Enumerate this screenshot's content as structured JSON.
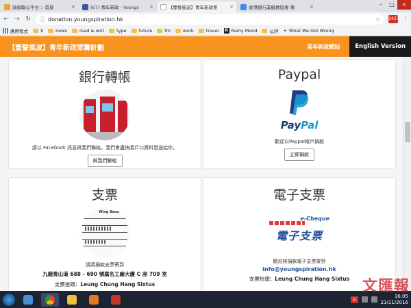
{
  "browser": {
    "tabs": [
      {
        "label": "誠倡聯公平台 :: 首頁",
        "color": "#e8a43a"
      },
      {
        "label": "(67) 青年新政 - Youngs",
        "color": "#3b5998"
      },
      {
        "label": "【壹誓風波】青年新政第",
        "color": "#aaaaaa"
      },
      {
        "label": "香港銀行業僱員協會 陳",
        "color": "#4285f4"
      }
    ],
    "url": "donation.youngspiration.hk",
    "extension_badge": "2427",
    "bookmarks": [
      "應用程式",
      "$",
      "news",
      "read & writ",
      "type",
      "future",
      "fm",
      "work",
      "travel",
      "Rainy Mood",
      "公評",
      "What We Got Wrong"
    ]
  },
  "site": {
    "title": "【壹誓風波】青年新政眾籌計劃",
    "home_link": "青年新政網站",
    "english_button": "English Version"
  },
  "cards": {
    "bank": {
      "title": "銀行轉帳",
      "desc": "請以 Facebook 訊息與我們聯絡，我們會盡快將戶口資料發送給你。",
      "button": "與我們聯絡"
    },
    "paypal": {
      "title": "Paypal",
      "logo_pay": "Pay",
      "logo_pal": "Pal",
      "desc": "歡迎以Paypal帳戶捐款",
      "button": "立即捐款"
    },
    "cheque": {
      "title": "支票",
      "cheque_bank": "Wing Bank",
      "desc": "請將捐款支票寄到",
      "address": "九龍青山道 688 - 690 號嘉名工廠大廈 C 座 709 室",
      "payee_label": "支票抬頭：",
      "payee": "Leung Chung Hang Sixtus"
    },
    "echeque": {
      "title": "電子支票",
      "logo_en": "e-Cheque",
      "logo_zh": "電子支票",
      "desc": "歡迎將捐款電子支票寄到",
      "email": "info@youngspiration.hk",
      "payee_label": "支票抬頭：",
      "payee": "Leung Chung Hang Sixtus"
    }
  },
  "taskbar": {
    "time": "16:05",
    "date": "23/11/2016",
    "lang": "A",
    "apps": [
      "windows-explorer",
      "chrome",
      "file-folder",
      "media-player",
      "browser-news"
    ]
  },
  "watermark": "文匯報"
}
